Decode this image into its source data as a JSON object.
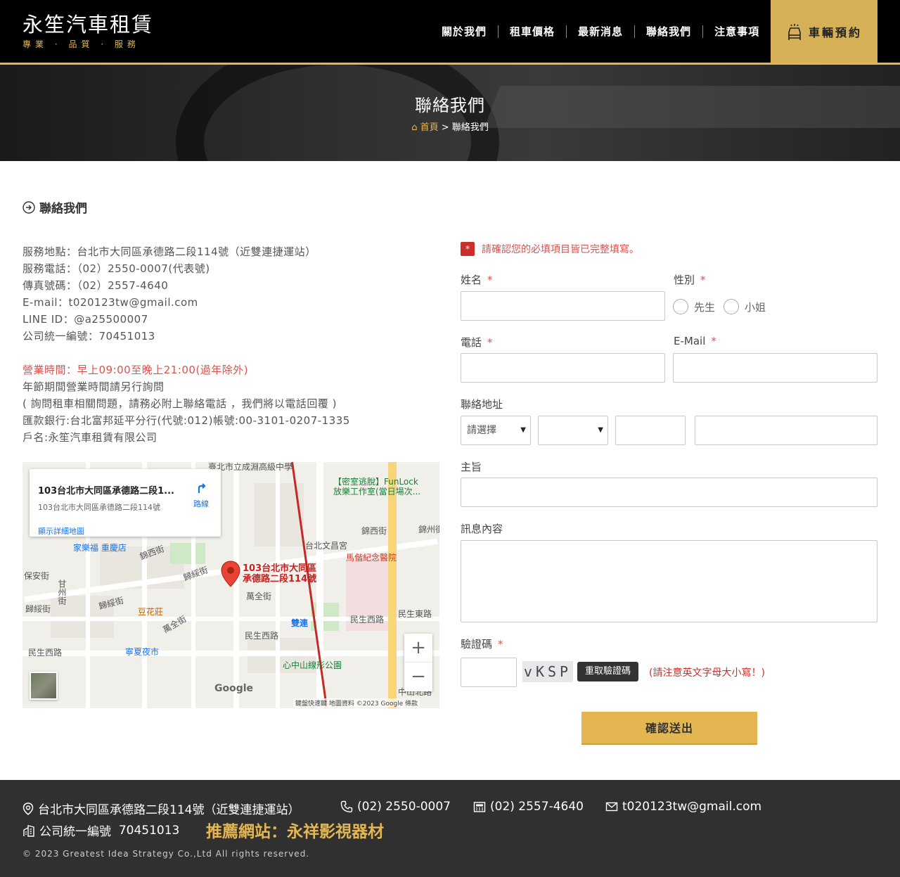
{
  "header": {
    "logo_title": "永笙汽車租賃",
    "logo_sub": "專業 · 品質 · 服務",
    "nav": [
      "關於我們",
      "租車價格",
      "最新消息",
      "聯絡我們",
      "注意事項"
    ],
    "book_label": "車輛預約",
    "accent": "#e3b652"
  },
  "banner": {
    "title": "聯絡我們",
    "breadcrumb_home": "首頁",
    "breadcrumb_sep": ">",
    "breadcrumb_current": "聯絡我們"
  },
  "section": {
    "title": "聯絡我們"
  },
  "info": {
    "address": "服務地點：台北市大同區承德路二段114號（近雙連捷運站）",
    "phone": "服務電話：（02）2550-0007(代表號)",
    "fax": "傳真號碼：（02）2557-4640",
    "email": "E-mail：t020123tw@gmail.com",
    "line": "LINE ID：@a25500007",
    "tax_id": "公司統一編號：70451013",
    "hours": "營業時間：早上09:00至晚上21:00(過年除外)",
    "holiday": "年節期間營業時間請另行詢問",
    "note": "( 詢問租車相關問題，請務必附上聯絡電話 ，我們將以電話回覆 )",
    "bank": "匯款銀行:台北富邦延平分行(代號:012)帳號:00-3101-0207-1335",
    "account": "戶名:永笙汽車租賃有限公司"
  },
  "map": {
    "card_title": "103台北市大同區承德路二段1...",
    "card_addr": "103台北市大同區承德路二段114號",
    "card_link": "顯示詳細地圖",
    "directions": "路線",
    "pin_label_1": "103台北市大同區",
    "pin_label_2": "承德路二段114號",
    "labels": {
      "school": "臺北市立成淵高級中學",
      "escape1": "【密室逃脫】FunLock",
      "escape2": "放樂工作室(當日場次...",
      "jinxi": "錦西街",
      "jinzhou": "錦州街",
      "carrefour": "家樂福 重慶店",
      "jinxi2": "錦西街",
      "wenchang": "台北文昌宮",
      "mackay": "馬偕紀念醫院",
      "baoan": "保安街",
      "guisui": "歸綏街",
      "ganzhou": "甘州街",
      "guisui2": "歸綏街",
      "guisui3": "歸綏街",
      "douhua": "豆花莊",
      "wanquan": "萬全街",
      "wanquan2": "萬全街",
      "shuanglian": "雙連",
      "minsheng_w": "民生西路",
      "minsheng_w2": "民生西路",
      "minsheng_e": "民生東路",
      "minsheng_w3": "民生西路",
      "ningxia": "寧夏夜市",
      "park": "心中山線形公園",
      "zhongshan_n": "中山北路"
    },
    "zoom_in": "+",
    "zoom_out": "−",
    "google": "Google",
    "attribution": "鍵盤快速鍵  地圖資料 ©2023 Google  條款"
  },
  "form": {
    "alert": "請確認您的必填項目皆已完整填寫。",
    "required_mark": "*",
    "name_label": "姓名",
    "gender_label": "性別",
    "gender_options": [
      "先生",
      "小姐"
    ],
    "phone_label": "電話",
    "email_label": "E-Mail",
    "address_label": "聯絡地址",
    "city_placeholder": "請選擇",
    "district_placeholder": "",
    "subject_label": "主旨",
    "message_label": "訊息內容",
    "captcha_label": "驗證碼",
    "captcha_text": "vKSP",
    "refresh_label": "重取驗證碼",
    "captcha_note": "(請注意英文字母大小寫！)",
    "submit_label": "確認送出"
  },
  "footer": {
    "address": "台北市大同區承德路二段114號（近雙連捷運站）",
    "phone": "(02) 2550-0007",
    "fax": "(02) 2557-4640",
    "email": "t020123tw@gmail.com",
    "tax_label": "公司統一編號",
    "tax_id": "70451013",
    "recommend": "推薦網站：永祥影視器材",
    "copyright": "© 2023   Greatest Idea Strategy Co.,Ltd All rights reserved."
  }
}
